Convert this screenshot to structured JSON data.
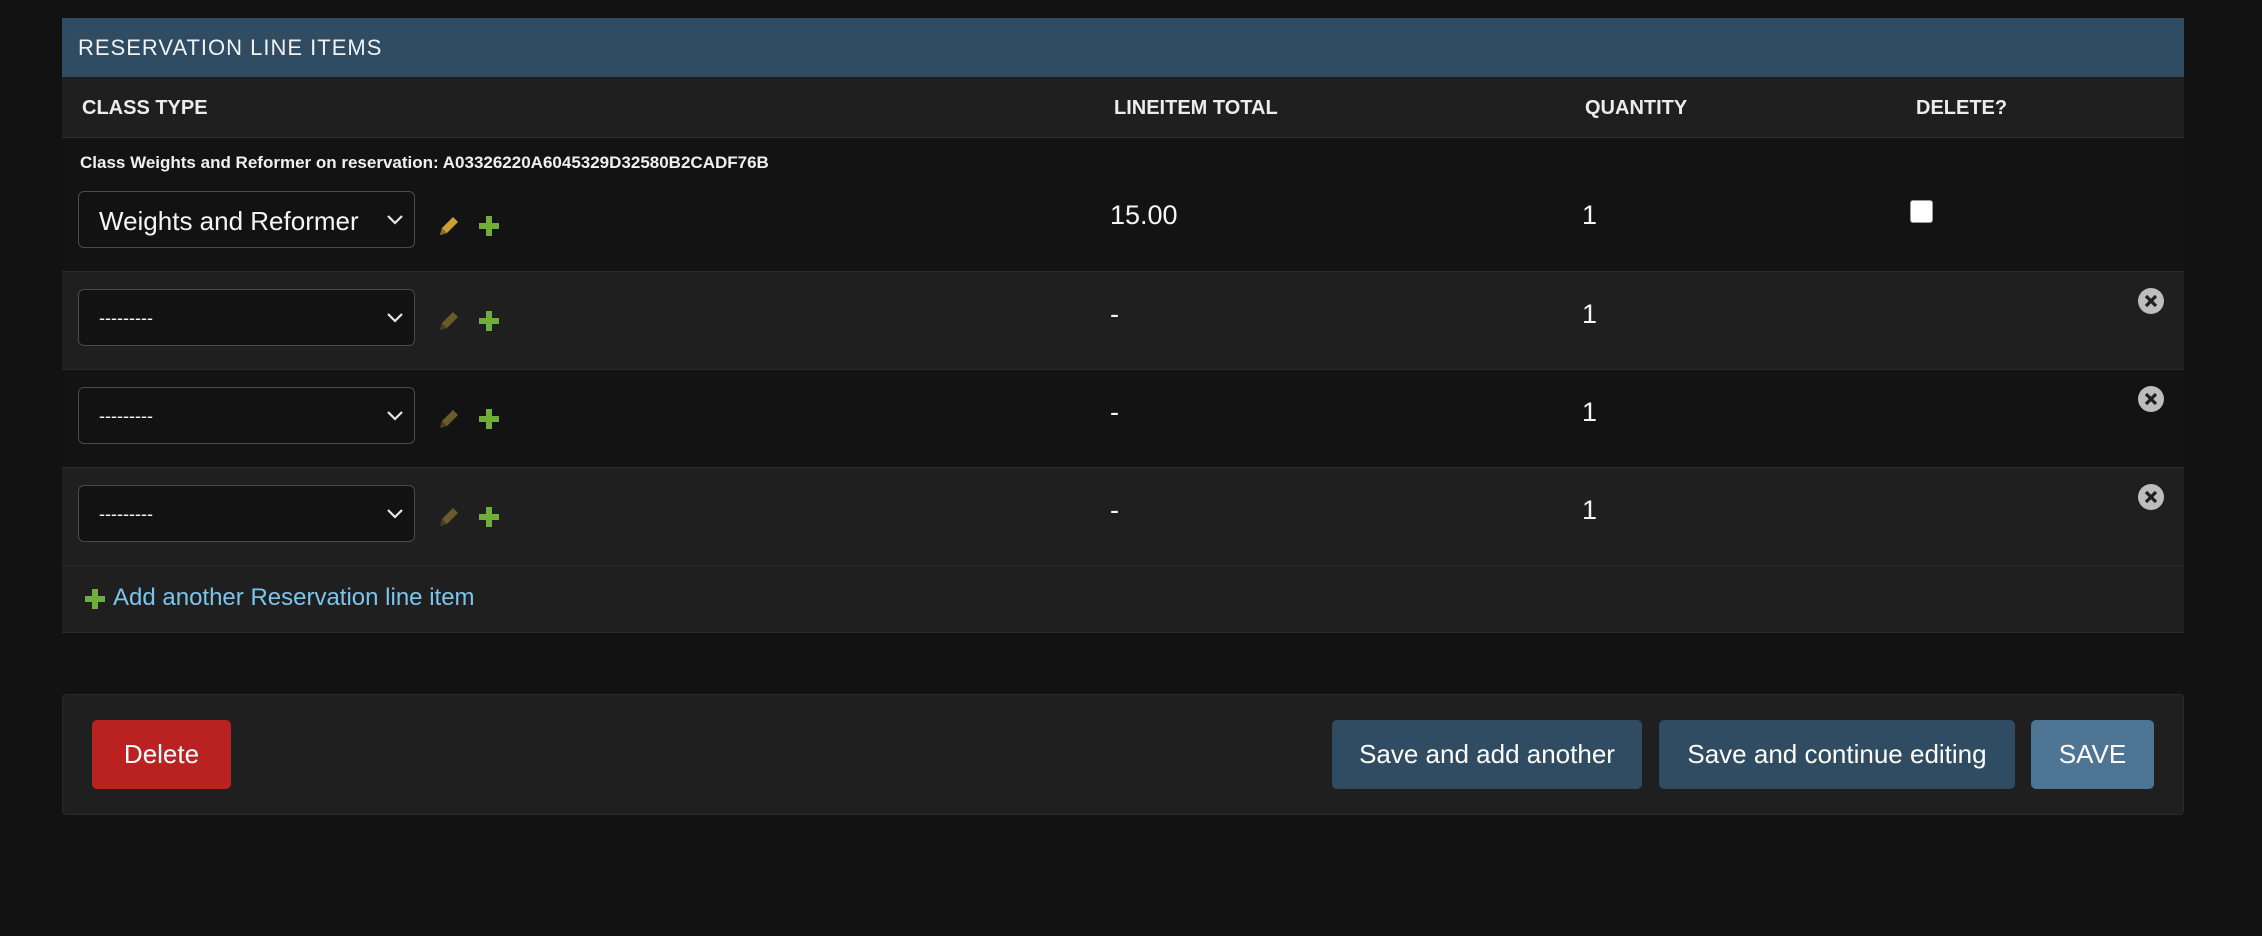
{
  "module": {
    "caption": "RESERVATION LINE ITEMS"
  },
  "columns": {
    "class_type": "CLASS TYPE",
    "lineitem_total": "LINEITEM TOTAL",
    "quantity": "QUANTITY",
    "delete": "DELETE?"
  },
  "rows": [
    {
      "original_label": "Class Weights and Reformer on reservation: A03326220A6045329D32580B2CADF76B",
      "class_type": "Weights and Reformer",
      "lineitem_total": "15.00",
      "quantity": "1",
      "delete_checked": false
    },
    {
      "class_type": "---------",
      "lineitem_total": "-",
      "quantity": "1"
    },
    {
      "class_type": "---------",
      "lineitem_total": "-",
      "quantity": "1"
    },
    {
      "class_type": "---------",
      "lineitem_total": "-",
      "quantity": "1"
    }
  ],
  "add_another": "Add another Reservation line item",
  "submit": {
    "delete": "Delete",
    "save_add_another": "Save and add another",
    "save_continue": "Save and continue editing",
    "save": "SAVE"
  },
  "colors": {
    "caption_bg": "#2f4c63",
    "delete_btn": "#ba2121",
    "save_btn": "#4e7593",
    "link": "#7cc4ec",
    "add_icon": "#6fae3a",
    "edit_icon": "#c9a233"
  },
  "icons": {
    "edit": "pencil-icon",
    "add": "plus-icon",
    "remove": "close-circle-icon",
    "dropdown": "chevron-down-icon"
  }
}
